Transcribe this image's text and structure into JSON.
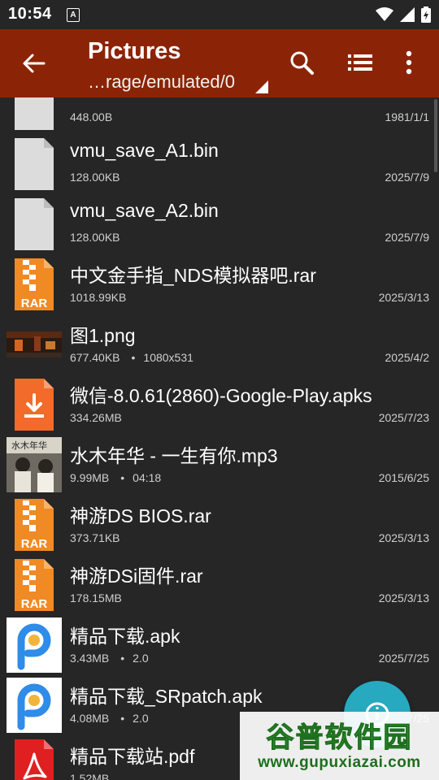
{
  "status": {
    "time": "10:54",
    "notif_letter": "A"
  },
  "appbar": {
    "title": "Pictures",
    "path": "…rage/emulated/0"
  },
  "files": [
    {
      "name": "",
      "size": "448.00B",
      "extra": "",
      "date": "1981/1/1",
      "icon": "generic-file-icon"
    },
    {
      "name": "vmu_save_A1.bin",
      "size": "128.00KB",
      "extra": "",
      "date": "2025/7/9",
      "icon": "generic-file-icon"
    },
    {
      "name": "vmu_save_A2.bin",
      "size": "128.00KB",
      "extra": "",
      "date": "2025/7/9",
      "icon": "generic-file-icon"
    },
    {
      "name": "中文金手指_NDS模拟器吧.rar",
      "size": "1018.99KB",
      "extra": "",
      "date": "2025/3/13",
      "icon": "rar-archive-icon"
    },
    {
      "name": "图1.png",
      "size": "677.40KB",
      "extra": "1080x531",
      "date": "2025/4/2",
      "icon": "image-thumbnail"
    },
    {
      "name": "微信-8.0.61(2860)-Google-Play.apks",
      "size": "334.26MB",
      "extra": "",
      "date": "2025/7/23",
      "icon": "apks-download-icon"
    },
    {
      "name": "水木年华 - 一生有你.mp3",
      "size": "9.99MB",
      "extra": "04:18",
      "date": "2015/6/25",
      "icon": "album-art-thumbnail",
      "album_text": "水木年华"
    },
    {
      "name": "神游DS BIOS.rar",
      "size": "373.71KB",
      "extra": "",
      "date": "2025/3/13",
      "icon": "rar-archive-icon"
    },
    {
      "name": "神游DSi固件.rar",
      "size": "178.15MB",
      "extra": "",
      "date": "2025/3/13",
      "icon": "rar-archive-icon"
    },
    {
      "name": "精品下载.apk",
      "size": "3.43MB",
      "extra": "2.0",
      "date": "2025/7/25",
      "icon": "app-icon"
    },
    {
      "name": "精品下载_SRpatch.apk",
      "size": "4.08MB",
      "extra": "2.0",
      "date": "7/25",
      "icon": "app-icon"
    },
    {
      "name": "精品下载站.pdf",
      "size": "1.52MB",
      "extra": "",
      "date": "",
      "icon": "pdf-icon"
    }
  ],
  "rar_label": "RAR",
  "watermark": {
    "top": "谷普软件园",
    "url": "www.gupuxiazai.com"
  },
  "colors": {
    "appbar": "#8b2406",
    "background": "#262626",
    "fab": "#27a9c0",
    "rar_orange": "#f08a24"
  }
}
